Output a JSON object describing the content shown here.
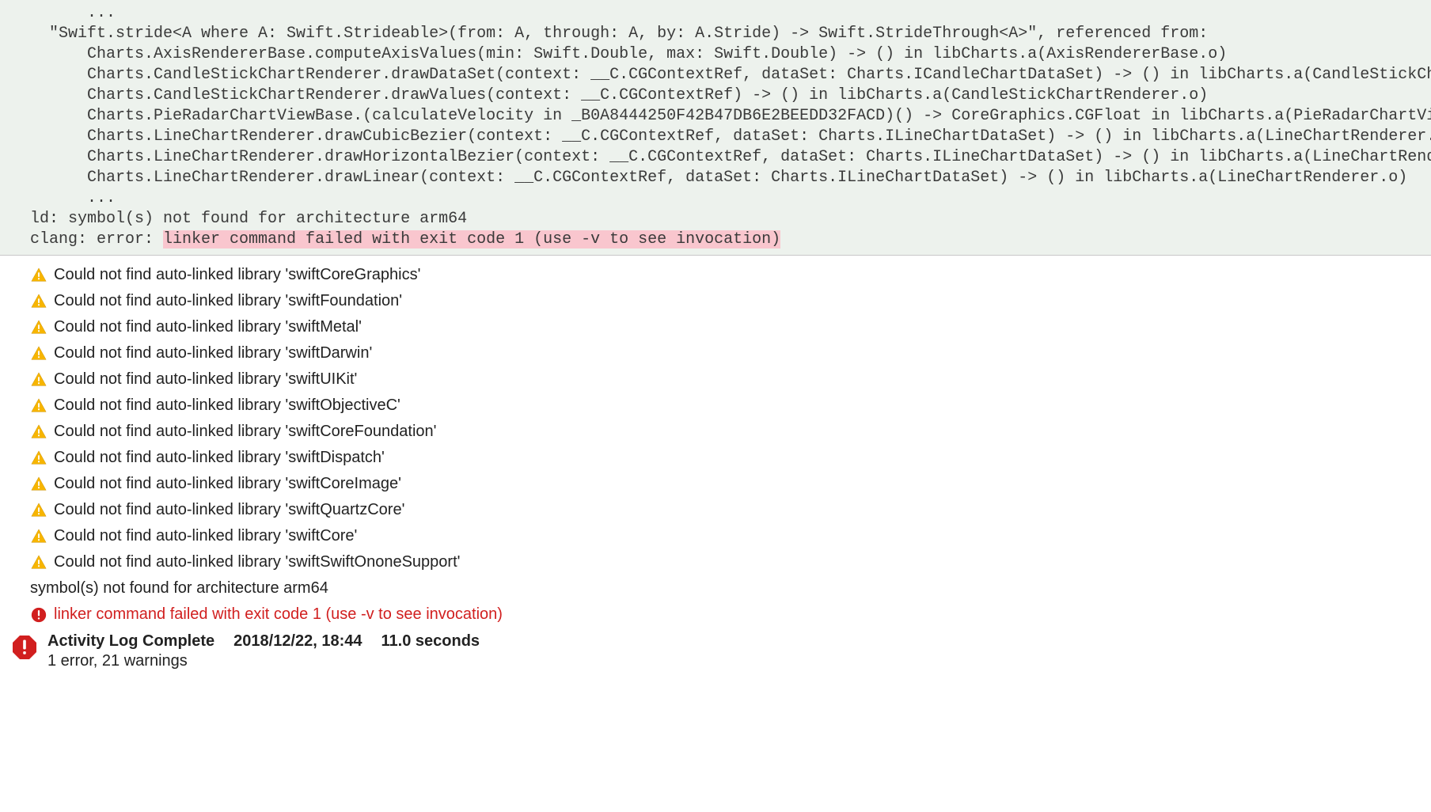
{
  "console": {
    "lines": [
      "      ...",
      "  \"Swift.stride<A where A: Swift.Strideable>(from: A, through: A, by: A.Stride) -> Swift.StrideThrough<A>\", referenced from:",
      "      Charts.AxisRendererBase.computeAxisValues(min: Swift.Double, max: Swift.Double) -> () in libCharts.a(AxisRendererBase.o)",
      "      Charts.CandleStickChartRenderer.drawDataSet(context: __C.CGContextRef, dataSet: Charts.ICandleChartDataSet) -> () in libCharts.a(CandleStickChartRenderer.o)",
      "      Charts.CandleStickChartRenderer.drawValues(context: __C.CGContextRef) -> () in libCharts.a(CandleStickChartRenderer.o)",
      "      Charts.PieRadarChartViewBase.(calculateVelocity in _B0A8444250F42B47DB6E2BEEDD32FACD)() -> CoreGraphics.CGFloat in libCharts.a(PieRadarChartViewBase.o)",
      "      Charts.LineChartRenderer.drawCubicBezier(context: __C.CGContextRef, dataSet: Charts.ILineChartDataSet) -> () in libCharts.a(LineChartRenderer.o)",
      "      Charts.LineChartRenderer.drawHorizontalBezier(context: __C.CGContextRef, dataSet: Charts.ILineChartDataSet) -> () in libCharts.a(LineChartRenderer.o)",
      "      Charts.LineChartRenderer.drawLinear(context: __C.CGContextRef, dataSet: Charts.ILineChartDataSet) -> () in libCharts.a(LineChartRenderer.o)",
      "      ..."
    ],
    "ld_line": "ld: symbol(s) not found for architecture arm64",
    "clang_prefix": "clang: error: ",
    "clang_highlight": "linker command failed with exit code 1 (use -v to see invocation)"
  },
  "warnings": [
    "Could not find auto-linked library 'swiftCoreGraphics'",
    "Could not find auto-linked library 'swiftFoundation'",
    "Could not find auto-linked library 'swiftMetal'",
    "Could not find auto-linked library 'swiftDarwin'",
    "Could not find auto-linked library 'swiftUIKit'",
    "Could not find auto-linked library 'swiftObjectiveC'",
    "Could not find auto-linked library 'swiftCoreFoundation'",
    "Could not find auto-linked library 'swiftDispatch'",
    "Could not find auto-linked library 'swiftCoreImage'",
    "Could not find auto-linked library 'swiftQuartzCore'",
    "Could not find auto-linked library 'swiftCore'",
    "Could not find auto-linked library 'swiftSwiftOnoneSupport'"
  ],
  "plain_line": "symbol(s) not found for architecture arm64",
  "error_line": "linker command failed with exit code 1 (use -v to see invocation)",
  "summary": {
    "title": "Activity Log Complete",
    "timestamp": "2018/12/22, 18:44",
    "duration": "11.0 seconds",
    "subtitle": "1 error, 21 warnings"
  }
}
